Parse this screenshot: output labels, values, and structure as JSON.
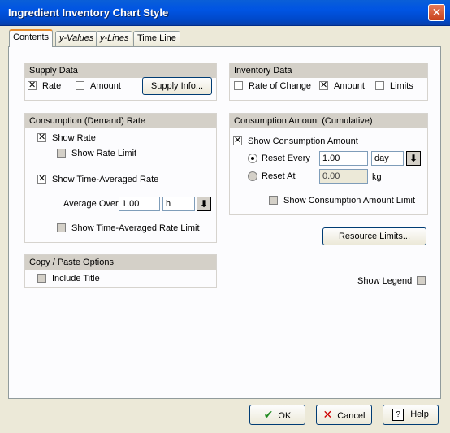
{
  "window": {
    "title": "Ingredient Inventory Chart Style",
    "close_icon": "close-icon"
  },
  "tabs": [
    {
      "label": "Contents",
      "active": true
    },
    {
      "label": "y-Values",
      "active": false
    },
    {
      "label": "y-Lines",
      "active": false
    },
    {
      "label": "Time Line",
      "active": false
    }
  ],
  "supply_data": {
    "title": "Supply Data",
    "rate": {
      "label": "Rate",
      "checked": true
    },
    "amount": {
      "label": "Amount",
      "checked": false
    },
    "info_button": "Supply Info..."
  },
  "inventory_data": {
    "title": "Inventory Data",
    "rate_of_change": {
      "label": "Rate of Change",
      "checked": false
    },
    "amount": {
      "label": "Amount",
      "checked": true
    },
    "limits": {
      "label": "Limits",
      "checked": false
    }
  },
  "consumption_rate": {
    "title": "Consumption (Demand) Rate",
    "show_rate": {
      "label": "Show Rate",
      "checked": true
    },
    "show_rate_limit": {
      "label": "Show Rate Limit",
      "checked": false
    },
    "show_time_averaged_rate": {
      "label": "Show Time-Averaged Rate",
      "checked": true
    },
    "average_over_label": "Average Over",
    "average_over_value": "1.00",
    "average_over_unit": "h",
    "show_time_averaged_rate_limit": {
      "label": "Show Time-Averaged Rate Limit",
      "checked": false
    }
  },
  "consumption_amount": {
    "title": "Consumption Amount (Cumulative)",
    "show_amount": {
      "label": "Show Consumption Amount",
      "checked": true
    },
    "reset_every": {
      "label": "Reset Every",
      "value": "1.00",
      "unit": "day",
      "selected": true
    },
    "reset_at": {
      "label": "Reset At",
      "value": "0.00",
      "unit": "kg",
      "selected": false
    },
    "show_amount_limit": {
      "label": "Show Consumption Amount Limit",
      "checked": false
    }
  },
  "resource_limits_button": "Resource Limits...",
  "copy_paste": {
    "title": "Copy / Paste Options",
    "include_title": {
      "label": "Include Title",
      "checked": false
    }
  },
  "show_legend": {
    "label": "Show Legend",
    "checked": false
  },
  "footer": {
    "ok": "OK",
    "cancel": "Cancel",
    "help": "Help"
  }
}
